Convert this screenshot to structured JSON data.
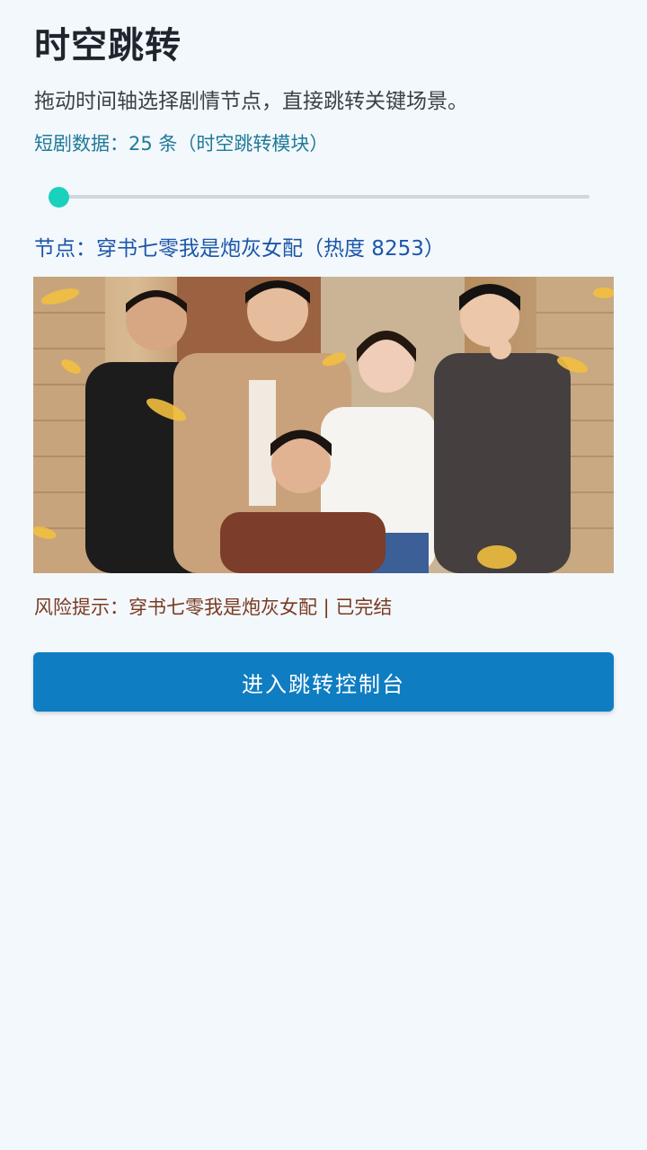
{
  "header": {
    "title": "时空跳转",
    "subtitle": "拖动时间轴选择剧情节点，直接跳转关键场景。",
    "data_line": "短剧数据：25 条（时空跳转模块）"
  },
  "timeline": {
    "position": 0
  },
  "node": {
    "label": "节点：穿书七零我是炮灰女配（热度 8253）"
  },
  "poster": {
    "alt": "穿书七零我是炮灰女配"
  },
  "risk": {
    "label": "风险提示：穿书七零我是炮灰女配 | 已完结"
  },
  "actions": {
    "enter_label": "进入跳转控制台"
  },
  "colors": {
    "accent": "#0f7dc2",
    "slider_thumb": "#1ad1bd",
    "node_text": "#1c56a8",
    "risk_text": "#7a3a20"
  }
}
